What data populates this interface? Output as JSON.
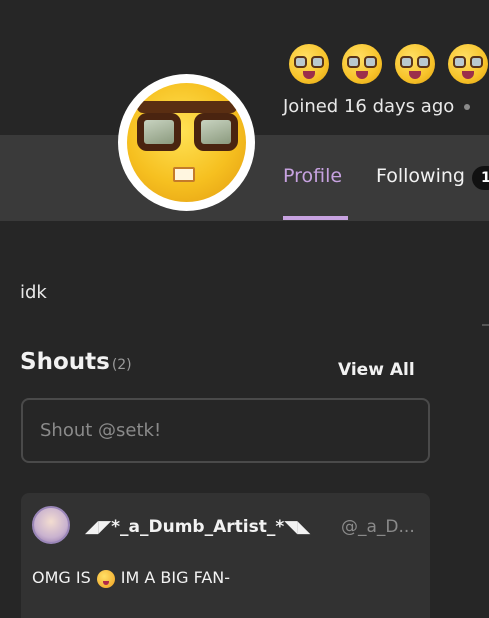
{
  "header": {
    "badges": [
      "nerd-face-emoji",
      "nerd-face-emoji",
      "nerd-face-emoji",
      "nerd-face-emoji"
    ],
    "joined_text": "Joined 16 days ago"
  },
  "tabs": {
    "profile_label": "Profile",
    "following_label": "Following",
    "following_count": "1"
  },
  "bio": "idk",
  "shouts": {
    "title": "Shouts",
    "count": "(2)",
    "view_all_label": "View All",
    "input_placeholder": "Shout @setk!",
    "items": [
      {
        "author": "◢◤*_a_Dumb_Artist_*◥◣",
        "handle": "@_a_D...",
        "text_before": "OMG IS",
        "text_after": "IM A BIG FAN-"
      }
    ]
  },
  "colors": {
    "accent": "#c7a2e0",
    "background": "#262626",
    "tab_band": "#3a3a3a",
    "card": "#323232"
  }
}
